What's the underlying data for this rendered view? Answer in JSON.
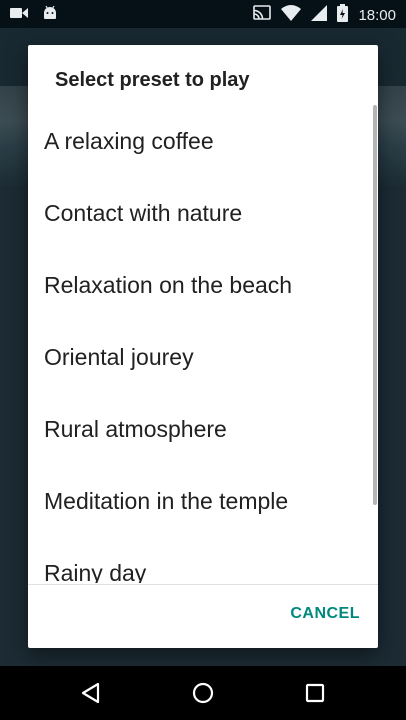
{
  "status_bar": {
    "time": "18:00",
    "left_icons": [
      "video-camera-icon",
      "android-icon"
    ],
    "right_icons": [
      "cast-icon",
      "wifi-icon",
      "signal-icon",
      "battery-icon"
    ]
  },
  "dialog": {
    "title": "Select preset to play",
    "items": [
      {
        "label": "A relaxing coffee"
      },
      {
        "label": "Contact with nature"
      },
      {
        "label": "Relaxation on the beach"
      },
      {
        "label": "Oriental jourey"
      },
      {
        "label": "Rural atmosphere"
      },
      {
        "label": "Meditation in the temple"
      },
      {
        "label": "Rainy day"
      }
    ],
    "cancel_label": "CANCEL"
  },
  "nav_bar": {
    "icons": [
      "back-icon",
      "home-icon",
      "recents-icon"
    ]
  },
  "colors": {
    "accent": "#00897b",
    "status_bar": "#061017",
    "dialog_bg": "#ffffff"
  }
}
